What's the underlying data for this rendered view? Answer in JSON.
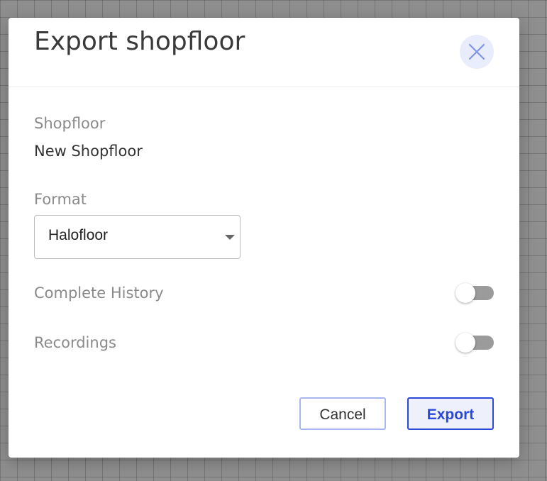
{
  "dialog": {
    "title": "Export shopfloor",
    "close_icon": "close-icon"
  },
  "shopfloor": {
    "label": "Shopfloor",
    "value": "New Shopfloor"
  },
  "format": {
    "label": "Format",
    "selected": "Halofloor"
  },
  "options": {
    "complete_history": {
      "label": "Complete History",
      "enabled": false
    },
    "recordings": {
      "label": "Recordings",
      "enabled": false
    }
  },
  "actions": {
    "cancel_label": "Cancel",
    "export_label": "Export"
  },
  "colors": {
    "accent": "#2b49d8",
    "accent_light": "#a9b7f0",
    "close_bg": "#e9ecfb",
    "toggle_off": "#9b9b9b"
  }
}
